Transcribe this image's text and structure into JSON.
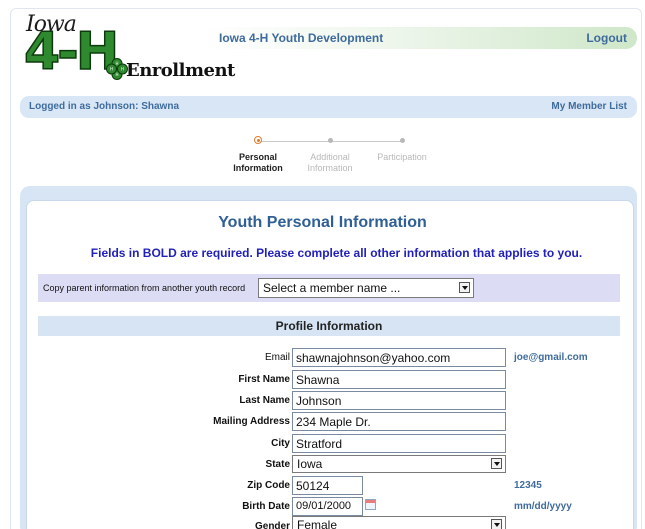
{
  "logo": {
    "iowa": "Iowa",
    "four_h": "4-H",
    "enrollment": "Enrollment"
  },
  "header": {
    "title": "Iowa 4-H Youth Development",
    "logout": "Logout"
  },
  "userbar": {
    "logged_in": "Logged in as Johnson: Shawna",
    "member_list": "My Member List"
  },
  "steps": [
    {
      "line1": "Personal",
      "line2": "Information",
      "state": "active"
    },
    {
      "line1": "Additional",
      "line2": "Information",
      "state": "inactive"
    },
    {
      "line1": "Participation",
      "line2": "",
      "state": "inactive"
    }
  ],
  "page": {
    "title": "Youth Personal Information",
    "required_note": "Fields in BOLD are required. Please complete all other information that applies to you."
  },
  "copy": {
    "label": "Copy parent information from another youth record",
    "select_value": "Select a member name ..."
  },
  "profile": {
    "section_title": "Profile Information",
    "email_label": "Email",
    "email_value": "shawnajohnson@yahoo.com",
    "email_hint": "joe@gmail.com",
    "first_name_label": "First Name",
    "first_name_value": "Shawna",
    "last_name_label": "Last Name",
    "last_name_value": "Johnson",
    "address_label": "Mailing Address",
    "address_value": "234 Maple Dr.",
    "city_label": "City",
    "city_value": "Stratford",
    "state_label": "State",
    "state_value": "Iowa",
    "zip_label": "Zip Code",
    "zip_value": "50124",
    "zip_hint": "12345",
    "birth_label": "Birth Date",
    "birth_value": "09/01/2000",
    "birth_hint": "mm/dd/yyyy",
    "gender_label": "Gender",
    "gender_value": "Female"
  },
  "colors": {
    "accent_blue": "#3e6b9c",
    "required_blue": "#2222bb",
    "step_active": "#e07b2d",
    "logo_green": "#2f8a2f"
  }
}
